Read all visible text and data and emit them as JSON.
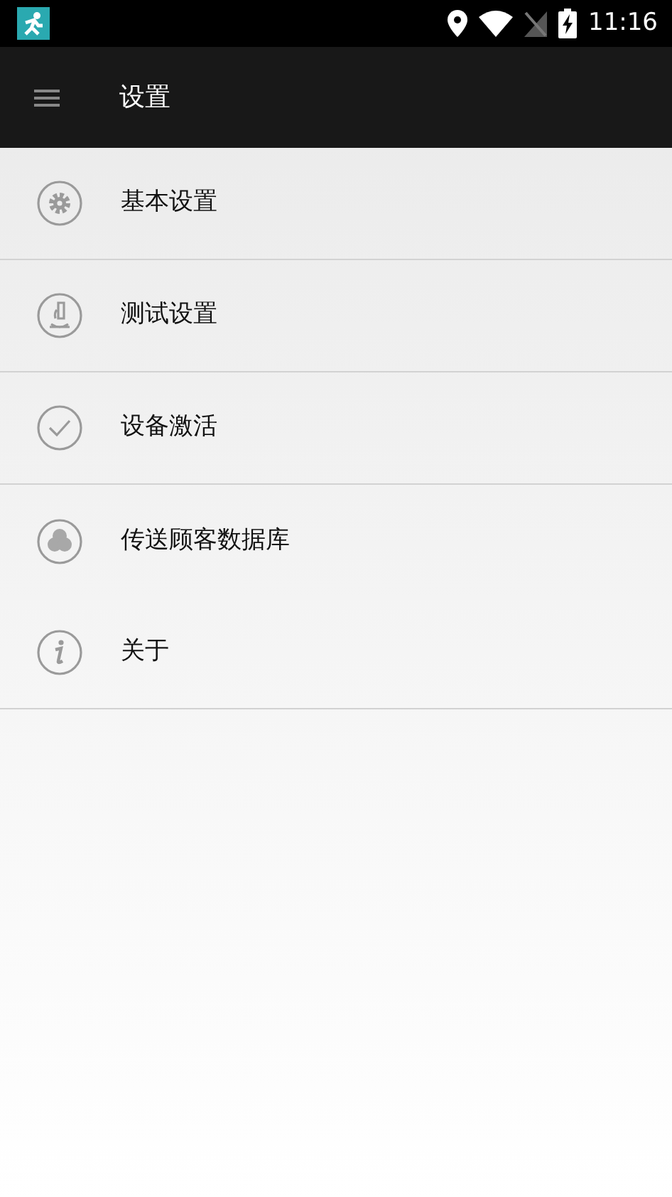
{
  "status_bar": {
    "time": "11:16"
  },
  "toolbar": {
    "title": "设置"
  },
  "menu": [
    {
      "kind": "gear",
      "label": "基本设置",
      "divider": true
    },
    {
      "kind": "microscope",
      "label": "测试设置",
      "divider": true
    },
    {
      "kind": "check",
      "label": "设备激活",
      "divider": true
    },
    {
      "kind": "circles",
      "label": "传送顾客数据库",
      "divider": false
    },
    {
      "kind": "info",
      "label": "关于",
      "divider": true
    }
  ]
}
